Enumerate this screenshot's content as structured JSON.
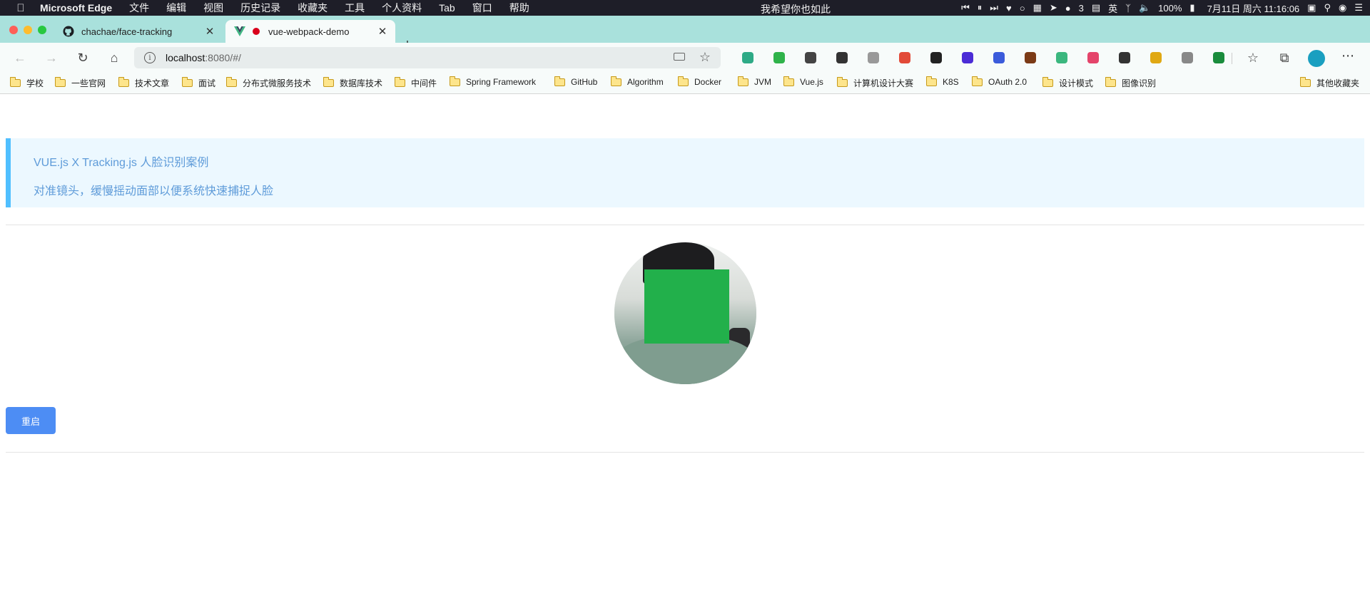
{
  "menubar": {
    "app_name": "Microsoft Edge",
    "items": [
      "文件",
      "编辑",
      "视图",
      "历史记录",
      "收藏夹",
      "工具",
      "个人资料",
      "Tab",
      "窗口",
      "帮助"
    ],
    "song_text": "我希望你也如此",
    "wechat_count": "3",
    "input_method": "英",
    "battery": "100%",
    "clock": "7月11日 周六  11:16:06"
  },
  "tabs": [
    {
      "title": "chachae/face-tracking",
      "favicon": "github-icon"
    },
    {
      "title": "vue-webpack-demo",
      "favicon": "vue-icon",
      "recording": true
    }
  ],
  "address": {
    "host": "localhost",
    "path": ":8080/#/"
  },
  "extensions": [
    {
      "name": "s-extension-icon",
      "color": "#2eaa86"
    },
    {
      "name": "shield-check-icon",
      "color": "#2fb34a"
    },
    {
      "name": "gray-circle-icon",
      "color": "#444444"
    },
    {
      "name": "json-braces-icon",
      "color": "#333333"
    },
    {
      "name": "mask-icon",
      "color": "#999999"
    },
    {
      "name": "people-icon",
      "color": "#e24a38"
    },
    {
      "name": "tampermonkey-icon",
      "color": "#222222"
    },
    {
      "name": "purple-extension-icon",
      "color": "#4b2cd6"
    },
    {
      "name": "new-badge-extension-icon",
      "color": "#3b5bdb"
    },
    {
      "name": "brown-extension-icon",
      "color": "#7b3a16"
    },
    {
      "name": "vue-devtools-icon",
      "color": "#3bb77e"
    },
    {
      "name": "pink-extension-icon",
      "color": "#e4446a"
    },
    {
      "name": "dark-circle-icon",
      "color": "#333333"
    },
    {
      "name": "yellow-key-icon",
      "color": "#e0a813"
    },
    {
      "name": "gray-s-icon",
      "color": "#888888"
    },
    {
      "name": "green-h-icon",
      "color": "#1a8c3c"
    }
  ],
  "bookmarks": [
    "学校",
    "一些官网",
    "技术文章",
    "面试",
    "分布式微服务技术",
    "数据库技术",
    "中间件",
    "Spring Framework",
    "GitHub",
    "Algorithm",
    "Docker",
    "JVM",
    "Vue.js",
    "计算机设计大赛",
    "K8S",
    "OAuth 2.0",
    "设计模式",
    "图像识别"
  ],
  "other_bookmarks": "其他收藏夹",
  "page": {
    "notice_title": "VUE.js X Tracking.js 人脸识别案例",
    "notice_subtitle": "对准镜头，缓慢摇动面部以便系统快速捕捉人脸",
    "restart_label": "重启"
  }
}
